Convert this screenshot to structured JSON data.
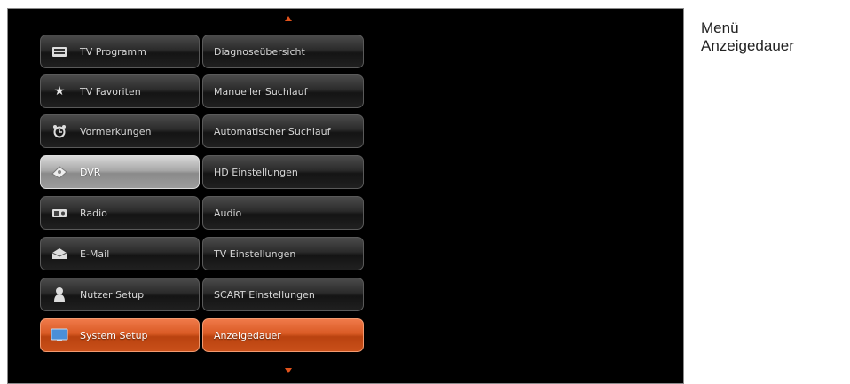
{
  "menu": {
    "main_items": [
      {
        "label": "TV Programm",
        "icon": "tv-guide-icon"
      },
      {
        "label": "TV Favoriten",
        "icon": "star-icon"
      },
      {
        "label": "Vormerkungen",
        "icon": "alarm-clock-icon"
      },
      {
        "label": "DVR",
        "icon": "dvr-disc-icon"
      },
      {
        "label": "Radio",
        "icon": "radio-icon"
      },
      {
        "label": "E-Mail",
        "icon": "mail-icon"
      },
      {
        "label": "Nutzer Setup",
        "icon": "user-icon"
      },
      {
        "label": "System Setup",
        "icon": "system-setup-icon"
      }
    ],
    "sub_items": [
      {
        "label": "Diagnoseübersicht"
      },
      {
        "label": "Manueller Suchlauf"
      },
      {
        "label": "Automatischer Suchlauf"
      },
      {
        "label": "HD Einstellungen"
      },
      {
        "label": "Audio"
      },
      {
        "label": "TV Einstellungen"
      },
      {
        "label": "SCART Einstellungen"
      },
      {
        "label": "Anzeigedauer"
      }
    ],
    "highlighted_main": "DVR",
    "selected_main": "System Setup",
    "selected_sub": "Anzeigedauer",
    "colors": {
      "accent": "#d95a24",
      "highlight": "#a8a8a8",
      "background": "#000000"
    }
  },
  "caption": {
    "line1": "Menü",
    "line2": "Anzeigedauer"
  }
}
